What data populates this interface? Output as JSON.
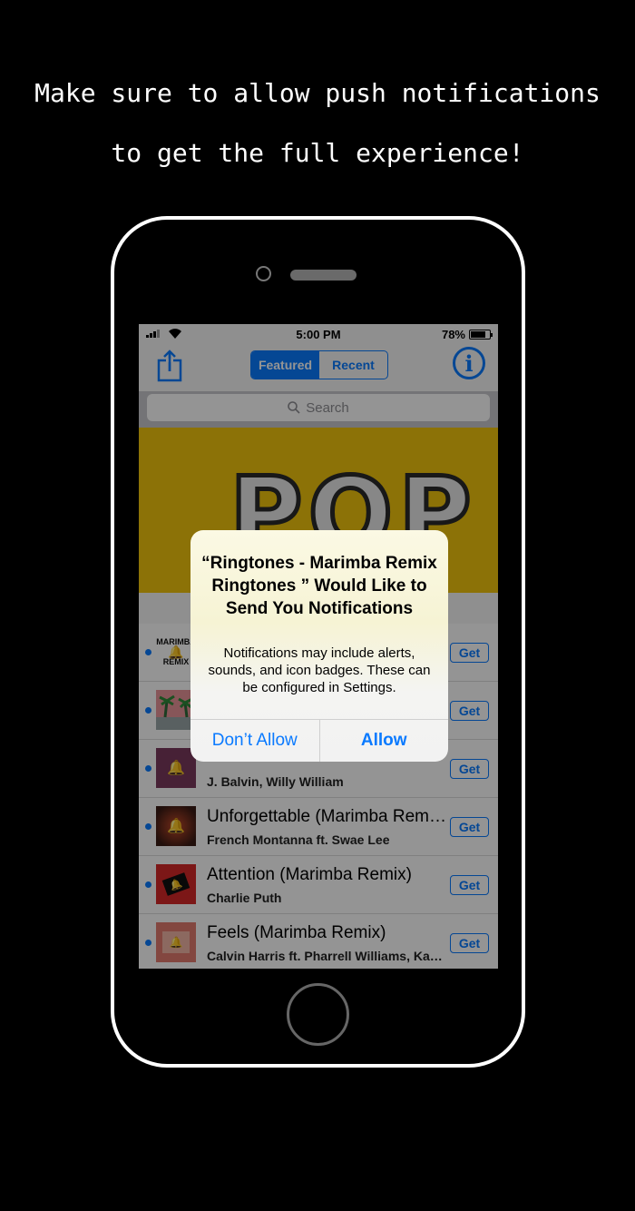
{
  "promo": {
    "line1": "Make sure to allow push notifications",
    "line2": "to get the full experience!"
  },
  "status": {
    "time": "5:00 PM",
    "battery": "78%",
    "battery_level": 0.78
  },
  "nav": {
    "share_icon": "share-icon",
    "segments": [
      "Featured",
      "Recent"
    ],
    "selected_segment": "Featured",
    "info_icon": "info-icon",
    "info_glyph": "i"
  },
  "search": {
    "placeholder": "Search"
  },
  "banner": {
    "text": "POP"
  },
  "list": [
    {
      "art_label_top": "MARIMBA",
      "art_label_bottom": "REMIX",
      "title": "",
      "artist": "",
      "get": "Get",
      "art_color": "#f4e34a"
    },
    {
      "title": "",
      "artist": "",
      "get": "Get",
      "art_color": "#e8959a"
    },
    {
      "title": "",
      "artist": "J. Balvin, Willy William",
      "get": "Get",
      "art_color": "#7a3a5e"
    },
    {
      "title": "Unforgettable (Marimba Remix)",
      "artist": "French Montanna ft. Swae Lee",
      "get": "Get",
      "art_color": "#5a2a20"
    },
    {
      "title": "Attention (Marimba Remix)",
      "artist": "Charlie Puth",
      "get": "Get",
      "art_color": "#d62828"
    },
    {
      "title": "Feels (Marimba Remix)",
      "artist": "Calvin Harris ft. Pharrell Williams, Katy Perry & Big Sean",
      "get": "Get",
      "art_color": "#e27a6e"
    }
  ],
  "alert": {
    "title": "“Ringtones - Marimba Remix Ringtones ” Would Like to Send You Notifications",
    "message": "Notifications may include alerts, sounds, and icon badges. These can be configured in Settings.",
    "deny": "Don’t Allow",
    "allow": "Allow"
  },
  "colors": {
    "accent": "#0a7aff",
    "banner": "#f2c40d"
  }
}
